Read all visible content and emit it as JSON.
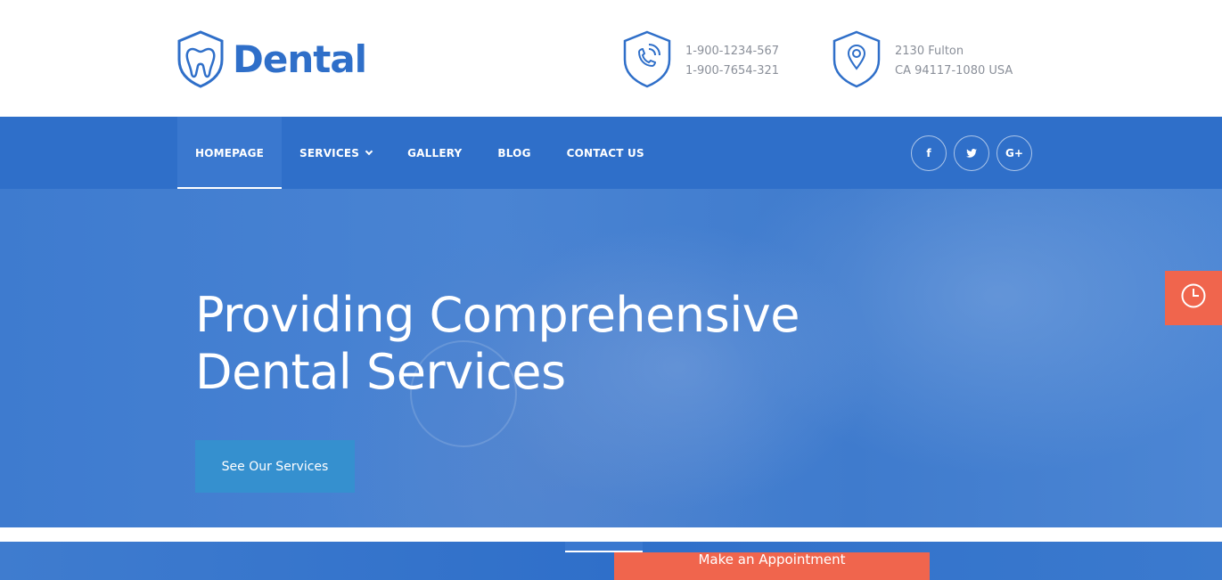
{
  "brand": {
    "name": "Dental",
    "color": "#2f6fc9"
  },
  "contacts": {
    "phone": {
      "icon": "phone-shield-icon",
      "line1": "1-900-1234-567",
      "line2": "1-900-7654-321"
    },
    "address": {
      "icon": "location-pin-shield-icon",
      "line1": "2130 Fulton",
      "line2": "CA 94117-1080 USA"
    }
  },
  "nav": {
    "items": [
      {
        "label": "HOMEPAGE",
        "active": true
      },
      {
        "label": "SERVICES",
        "has_dropdown": true
      },
      {
        "label": "GALLERY"
      },
      {
        "label": "BLOG"
      },
      {
        "label": "CONTACT US"
      }
    ]
  },
  "socials": [
    {
      "icon": "facebook-icon",
      "glyph": "f"
    },
    {
      "icon": "twitter-icon",
      "glyph": "🐦"
    },
    {
      "icon": "google-plus-icon",
      "glyph": "G+"
    }
  ],
  "hero": {
    "title_line1": "Providing Comprehensive",
    "title_line2": "Dental Services",
    "cta_label": "See Our Services"
  },
  "appointment": {
    "label": "Make an Appointment",
    "color": "#f0654d"
  },
  "clock_tab": {
    "icon": "clock-icon"
  }
}
